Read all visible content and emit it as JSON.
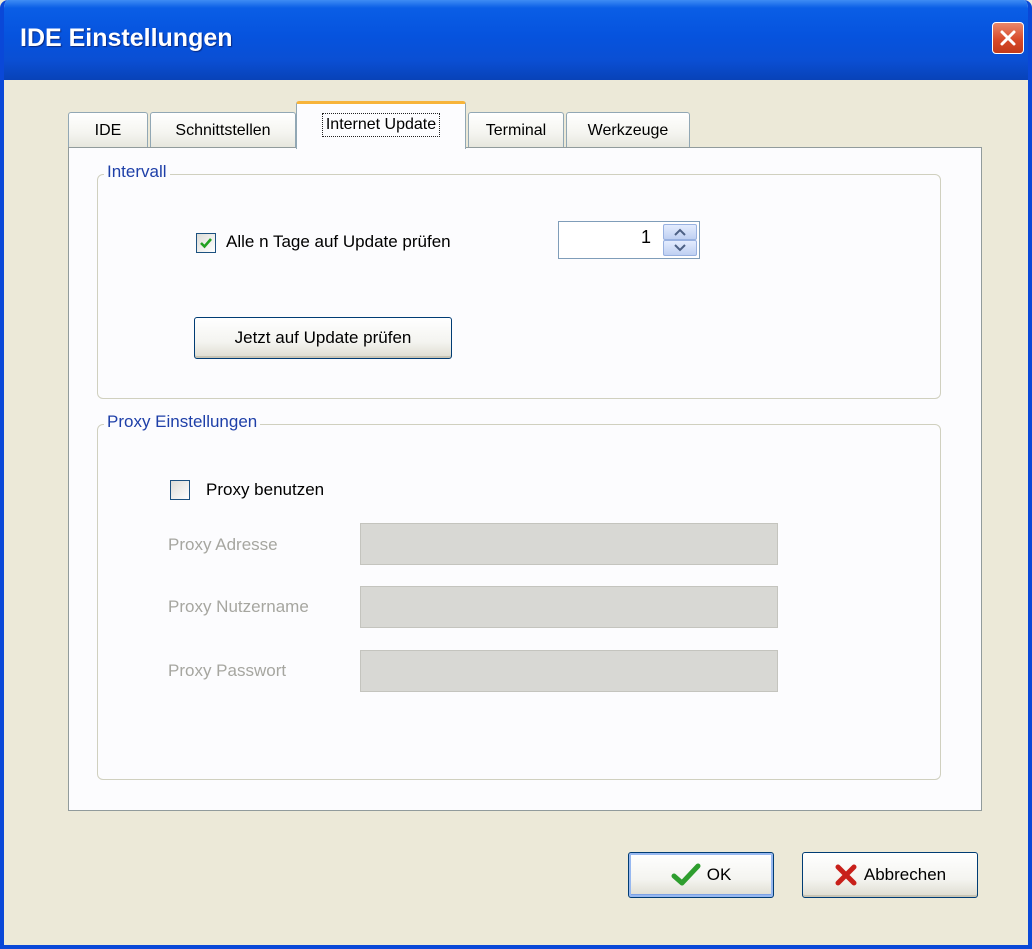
{
  "window": {
    "title": "IDE Einstellungen"
  },
  "tabs": [
    {
      "label": "IDE"
    },
    {
      "label": "Schnittstellen"
    },
    {
      "label": "Internet Update",
      "active": true
    },
    {
      "label": "Terminal"
    },
    {
      "label": "Werkzeuge"
    }
  ],
  "interval": {
    "title": "Intervall",
    "check_label": "Alle n Tage auf Update prüfen",
    "checked": true,
    "days_value": "1",
    "check_now_label": "Jetzt auf Update prüfen"
  },
  "proxy": {
    "title": "Proxy Einstellungen",
    "use_label": "Proxy benutzen",
    "checked": false,
    "address_label": "Proxy Adresse",
    "address_value": "",
    "username_label": "Proxy Nutzername",
    "username_value": "",
    "password_label": "Proxy Passwort",
    "password_value": ""
  },
  "footer": {
    "ok_label": "OK",
    "cancel_label": "Abbrechen"
  },
  "colors": {
    "titlebar": "#0653de",
    "group_title": "#1e3fa8",
    "active_tab_accent": "#f7b43a",
    "ok_check": "#2e9e2e",
    "cancel_x": "#c8201a"
  }
}
